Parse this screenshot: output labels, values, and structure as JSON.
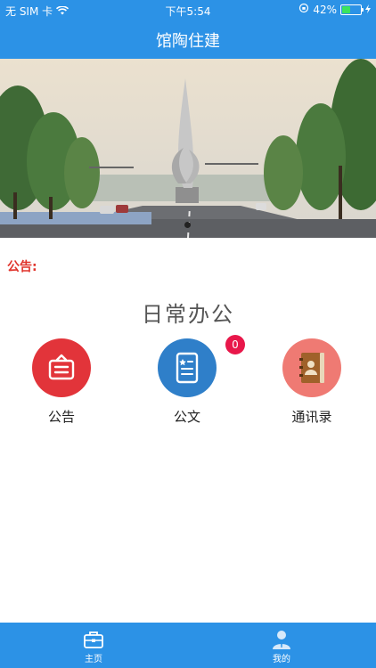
{
  "status_bar": {
    "carrier": "无 SIM 卡",
    "time": "下午5:54",
    "battery": "42%"
  },
  "header": {
    "title": "馆陶住建"
  },
  "notice": {
    "label": "公告:"
  },
  "section": {
    "title": "日常办公"
  },
  "apps": [
    {
      "label": "公告",
      "color": "#e2343a"
    },
    {
      "label": "公文",
      "color": "#2f7fc9",
      "badge": "0"
    },
    {
      "label": "通讯录",
      "color": "#ef7a73"
    }
  ],
  "tabbar": {
    "home": "主页",
    "mine": "我的"
  },
  "colors": {
    "brand": "#2c92e6",
    "notice": "#e0342c",
    "badge": "#e8174a"
  }
}
